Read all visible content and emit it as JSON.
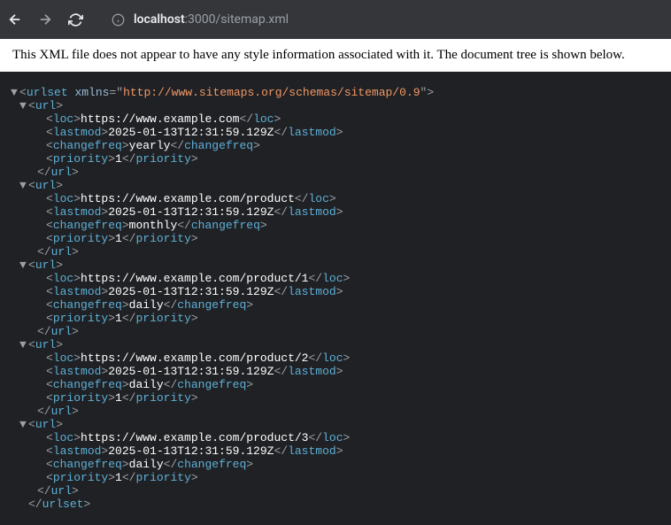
{
  "toolbar": {
    "url_host": "localhost",
    "url_port": ":3000",
    "url_path": "/sitemap.xml"
  },
  "banner": {
    "text": "This XML file does not appear to have any style information associated with it. The document tree is shown below."
  },
  "xml": {
    "root_tag": "urlset",
    "xmlns_attr": "xmlns",
    "xmlns_value": "http://www.sitemaps.org/schemas/sitemap/0.9",
    "url_tag": "url",
    "loc_tag": "loc",
    "lastmod_tag": "lastmod",
    "changefreq_tag": "changefreq",
    "priority_tag": "priority",
    "urls": [
      {
        "loc": "https://www.example.com",
        "lastmod": "2025-01-13T12:31:59.129Z",
        "changefreq": "yearly",
        "priority": "1"
      },
      {
        "loc": "https://www.example.com/product",
        "lastmod": "2025-01-13T12:31:59.129Z",
        "changefreq": "monthly",
        "priority": "1"
      },
      {
        "loc": "https://www.example.com/product/1",
        "lastmod": "2025-01-13T12:31:59.129Z",
        "changefreq": "daily",
        "priority": "1"
      },
      {
        "loc": "https://www.example.com/product/2",
        "lastmod": "2025-01-13T12:31:59.129Z",
        "changefreq": "daily",
        "priority": "1"
      },
      {
        "loc": "https://www.example.com/product/3",
        "lastmod": "2025-01-13T12:31:59.129Z",
        "changefreq": "daily",
        "priority": "1"
      }
    ]
  }
}
